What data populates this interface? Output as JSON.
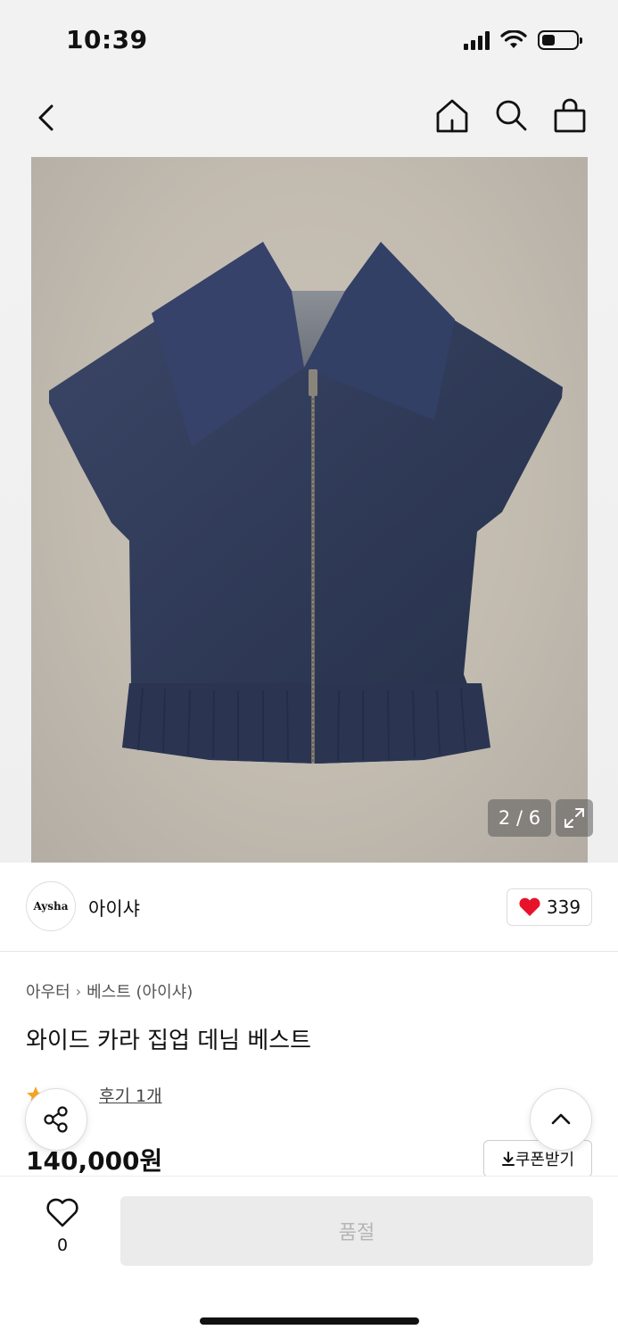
{
  "status_bar": {
    "time": "10:39",
    "icons": [
      "signal-icon",
      "wifi-icon",
      "battery-icon"
    ],
    "battery_level": 0.4
  },
  "nav": {
    "icons": [
      "back-icon",
      "home-icon",
      "search-icon",
      "shopping-bag-icon"
    ]
  },
  "gallery": {
    "counter": "2 / 6",
    "current": 2,
    "total": 6,
    "expand_icon": "expand-icon",
    "background_color": "#c2bbb0",
    "garment_color": "#2f3a55"
  },
  "brand": {
    "logo_text": "Aysha",
    "name": "아이샤",
    "like_count": "339",
    "like_color": "#e8132b"
  },
  "product": {
    "breadcrumb": [
      "아우터",
      "베스트 (아이샤)"
    ],
    "title": "와이드 카라 집업 데님 베스트",
    "review_text": "후기 1개",
    "price": "140,000원",
    "coupon_label": "쿠폰받기",
    "star_color": "#f5a623"
  },
  "bottom": {
    "wish_count": "0",
    "soldout_label": "품절"
  }
}
